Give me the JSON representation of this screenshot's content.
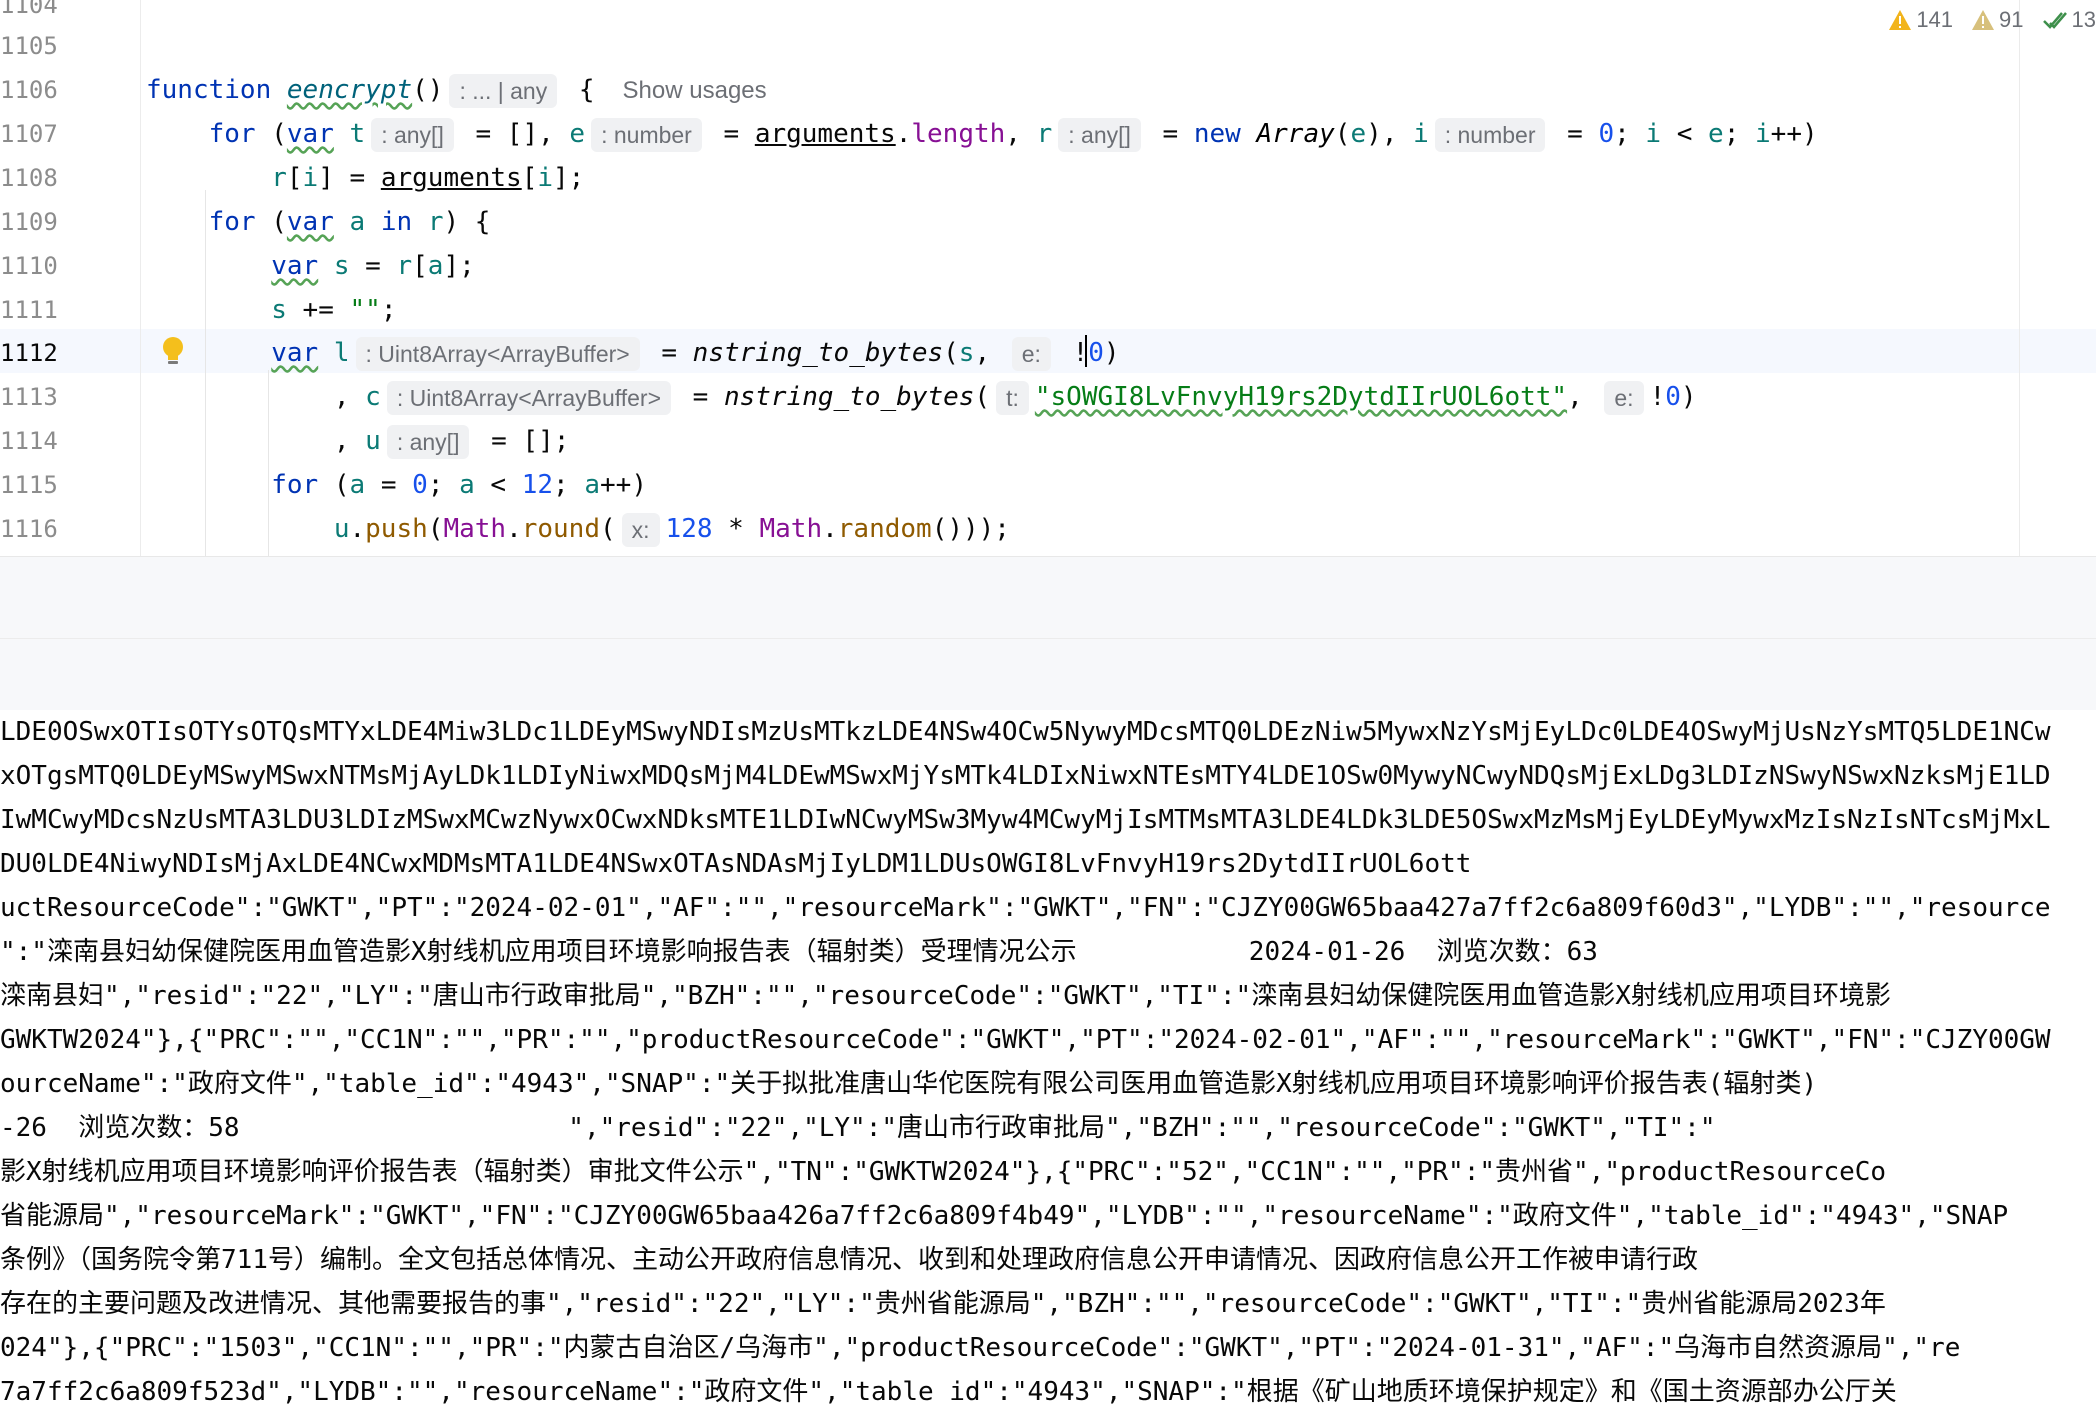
{
  "editor": {
    "line_numbers": [
      "1104",
      "1105",
      "1106",
      "1107",
      "1108",
      "1109",
      "1110",
      "1111",
      "1112",
      "1113",
      "1114",
      "1115",
      "1116"
    ],
    "show_usages": "Show usages",
    "inspections": {
      "warnings": "141",
      "weak_warnings": "91",
      "ok": "13"
    },
    "hints": {
      "fn_return": ": ... | any",
      "t": ": any[]",
      "e": ": number",
      "r": ": any[]",
      "i": ": number",
      "l": ": Uint8Array<ArrayBuffer>",
      "param_e": "e:",
      "c": ": Uint8Array<ArrayBuffer>",
      "param_t": "t:",
      "u": ": any[]",
      "param_x": "x:"
    },
    "string_literal": "\"sOWGI8LvFnvyH19rs2DytdIIrUOL6ott\""
  },
  "output": {
    "lines": [
      "LDE0OSwxOTIsOTYsOTQsMTYxLDE4Miw3LDc1LDEyMSwyNDIsMzUsMTkzLDE4NSw4OCw5NywyMDcsMTQ0LDEzNiw5MywxNzYsMjEyLDc0LDE4OSwyMjUsNzYsMTQ5LDE1NCw",
      "xOTgsMTQ0LDEyMSwyMSwxNTMsMjAyLDk1LDIyNiwxMDQsMjM4LDEwMSwxMjYsMTk4LDIxNiwxNTEsMTY4LDE1OSw0MywyNCwyNDQsMjExLDg3LDIzNSwyNSwxNzksMjE1LD",
      "IwMCwyMDcsNzUsMTA3LDU3LDIzMSwxMCwzNywxOCwxNDksMTE1LDIwNCwyMSw3Myw4MCwyMjIsMTMsMTA3LDE4LDk3LDE5OSwxMzMsMjEyLDEyMywxMzIsNzIsNTcsMjMxL",
      "DU0LDE4NiwyNDIsMjAxLDE4NCwxMDMsMTA1LDE4NSwxOTAsNDAsMjIyLDM1LDUsOWGI8LvFnvyH19rs2DytdIIrUOL6ott",
      "uctResourceCode\":\"GWKT\",\"PT\":\"2024-02-01\",\"AF\":\"\",\"resourceMark\":\"GWKT\",\"FN\":\"CJZY00GW65baa427a7ff2c6a809f60d3\",\"LYDB\":\"\",\"resource",
      "\":\"滦南县妇幼保健院医用血管造影X射线机应用项目环境影响报告表（辐射类）受理情况公示           2024-01-26  浏览次数：63",
      "滦南县妇\",\"resid\":\"22\",\"LY\":\"唐山市行政审批局\",\"BZH\":\"\",\"resourceCode\":\"GWKT\",\"TI\":\"滦南县妇幼保健院医用血管造影X射线机应用项目环境影",
      "GWKTW2024\"},{\"PRC\":\"\",\"CC1N\":\"\",\"PR\":\"\",\"productResourceCode\":\"GWKT\",\"PT\":\"2024-02-01\",\"AF\":\"\",\"resourceMark\":\"GWKT\",\"FN\":\"CJZY00GW",
      "ourceName\":\"政府文件\",\"table_id\":\"4943\",\"SNAP\":\"关于拟批准唐山华佗医院有限公司医用血管造影X射线机应用项目环境影响评价报告表(辐射类)",
      "-26  浏览次数：58                     \",\"resid\":\"22\",\"LY\":\"唐山市行政审批局\",\"BZH\":\"\",\"resourceCode\":\"GWKT\",\"TI\":\"",
      "影X射线机应用项目环境影响评价报告表（辐射类）审批文件公示\",\"TN\":\"GWKTW2024\"},{\"PRC\":\"52\",\"CC1N\":\"\",\"PR\":\"贵州省\",\"productResourceCo",
      "省能源局\",\"resourceMark\":\"GWKT\",\"FN\":\"CJZY00GW65baa426a7ff2c6a809f4b49\",\"LYDB\":\"\",\"resourceName\":\"政府文件\",\"table_id\":\"4943\",\"SNAP",
      "条例》（国务院令第711号）编制。全文包括总体情况、主动公开政府信息情况、收到和处理政府信息公开申请情况、因政府信息公开工作被申请行政",
      "存在的主要问题及改进情况、其他需要报告的事\",\"resid\":\"22\",\"LY\":\"贵州省能源局\",\"BZH\":\"\",\"resourceCode\":\"GWKT\",\"TI\":\"贵州省能源局2023年",
      "024\"},{\"PRC\":\"1503\",\"CC1N\":\"\",\"PR\":\"内蒙古自治区/乌海市\",\"productResourceCode\":\"GWKT\",\"PT\":\"2024-01-31\",\"AF\":\"乌海市自然资源局\",\"re",
      "7a7ff2c6a809f523d\",\"LYDB\":\"\",\"resourceName\":\"政府文件\",\"table_id\":\"4943\",\"SNAP\":\"根据《矿山地质环境保护规定》和《国土资源部办公厅关"
    ]
  }
}
